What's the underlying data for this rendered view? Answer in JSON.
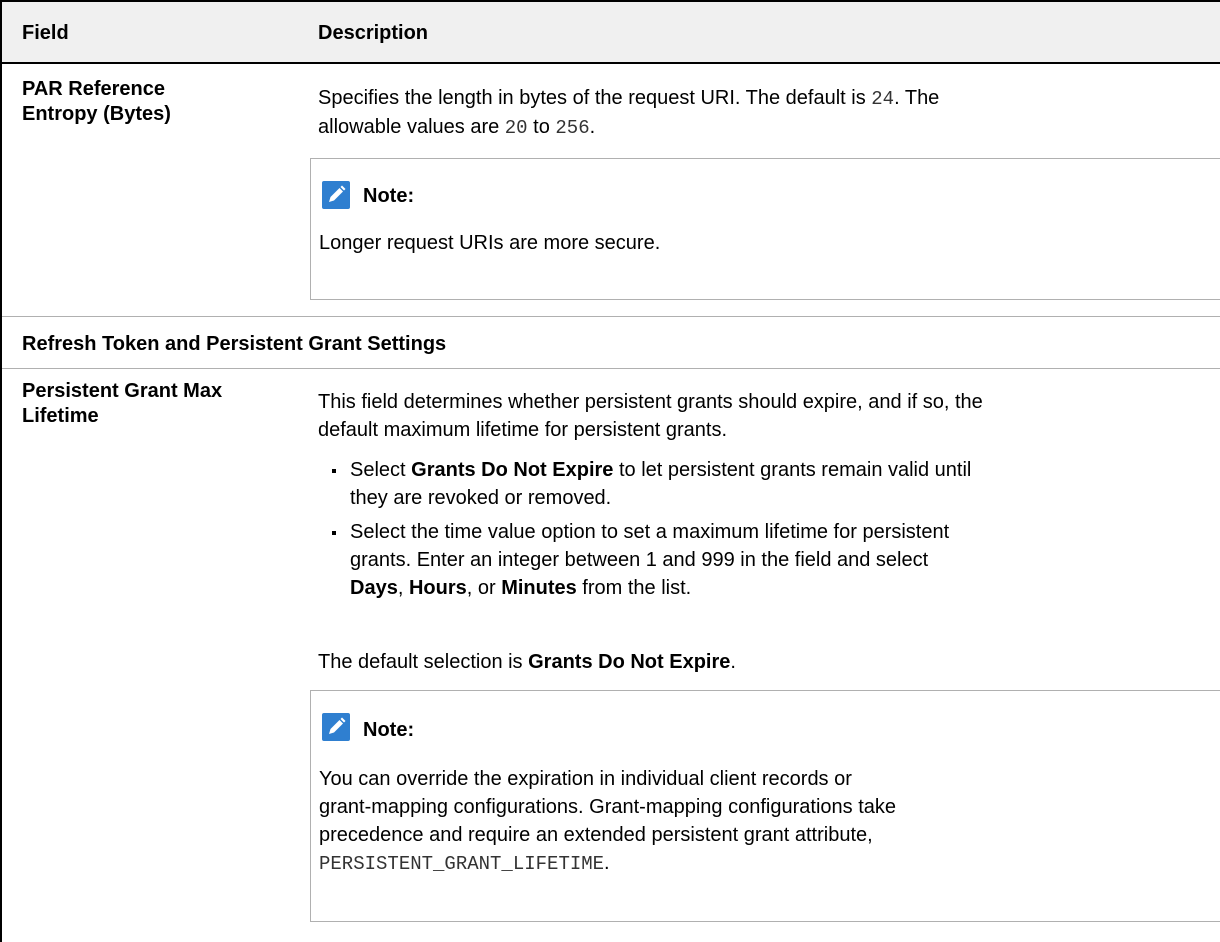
{
  "table": {
    "header": {
      "field": "Field",
      "description": "Description"
    },
    "row_par": {
      "field_line1": "PAR Reference",
      "field_line2": "Entropy (Bytes)",
      "desc_part1": "Specifies the length in bytes of the request URI. The default is ",
      "default_value": "24",
      "desc_part2": ". The",
      "desc_part3": "allowable values are ",
      "min_value": "20",
      "desc_part4": " to ",
      "max_value": "256",
      "desc_part5": ".",
      "note_label": "Note:",
      "note_text": "Longer request URIs are more secure."
    },
    "section_heading": "Refresh Token and Persistent Grant Settings",
    "row_grant": {
      "field_line1": "Persistent Grant Max",
      "field_line2": "Lifetime",
      "intro_line1": "This field determines whether persistent grants should expire, and if so, the",
      "intro_line2": "default maximum lifetime for persistent grants.",
      "bullet1_pre": "Select ",
      "bullet1_bold": "Grants Do Not Expire",
      "bullet1_line1_post": " to let persistent grants remain valid until",
      "bullet1_line2": "they are revoked or removed.",
      "bullet2_line1": "Select the time value option to set a maximum lifetime for persistent",
      "bullet2_line2": "grants. Enter an integer between 1 and 999 in the field and select",
      "bullet2_days": "Days",
      "bullet2_sep1": ", ",
      "bullet2_hours": "Hours",
      "bullet2_sep2": ", or ",
      "bullet2_minutes": "Minutes",
      "bullet2_tail": " from the list.",
      "default_pre": "The default selection is ",
      "default_bold": "Grants Do Not Expire",
      "default_post": ".",
      "note_label": "Note:",
      "note_line1": "You can override the expiration in individual client records or",
      "note_line2": "grant-mapping configurations. Grant-mapping configurations take",
      "note_line3": "precedence and require an extended persistent grant attribute,",
      "note_code": "PERSISTENT_GRANT_LIFETIME",
      "note_code_post": "."
    }
  },
  "colors": {
    "header_bg": "#f0f0f0",
    "note_icon": "#2f7fd0",
    "rule": "#b0b0b0",
    "code_text": "#333333"
  },
  "icons": {
    "note": "pencil-note-icon"
  }
}
